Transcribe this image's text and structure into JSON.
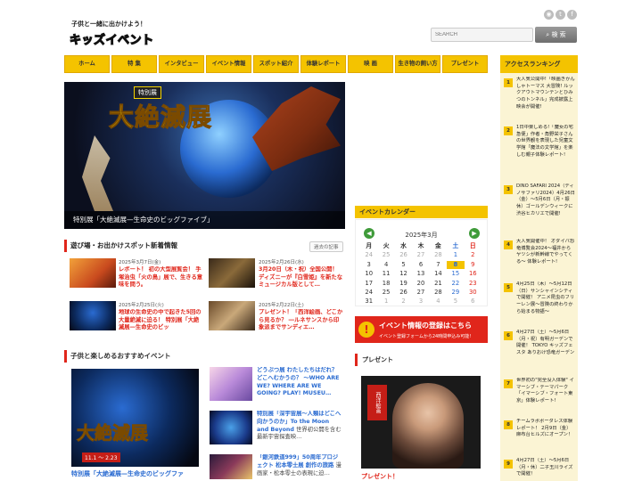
{
  "header": {
    "tagline": "子供と一緒に出かけよう！",
    "logo": "キッズイベント",
    "search_placeholder": "SEARCH",
    "search_button": "検 索",
    "social": [
      "rss-icon",
      "twitter-icon",
      "facebook-icon"
    ]
  },
  "nav": [
    "ホーム",
    "特 集",
    "インタビュー",
    "イベント情報",
    "スポット紹介",
    "体験レポート",
    "映 画",
    "生き物の飼い方",
    "プレゼント"
  ],
  "hero": {
    "badge": "特別展",
    "title": "大絶滅展",
    "caption": "特別展「大絶滅展—生命史のビッグファイブ」"
  },
  "news": {
    "heading": "遊び場・お出かけスポット新着情報",
    "more": "過去の記事",
    "items": [
      {
        "date": "2025年3月7日(金)",
        "title": "レポート！ 初の大型展覧会！ 手塚治虫「火の鳥」展で、生きる意味を問う。"
      },
      {
        "date": "2025年2月26日(水)",
        "title": "3月20日（木・祝）全国公開！ ディズニーが『白雪姫』を新たなミュージカル版として…"
      },
      {
        "date": "2025年2月25日(火)",
        "title": "地球の生命史の中で起きた5回の大量絶滅に迫る！ 特別展「大絶滅展—生命史のビッ"
      },
      {
        "date": "2025年2月22日(土)",
        "title": "プレゼント！「西洋絵画、どこから見るか？ ―ルネサンスから印象派までサンディエ…"
      }
    ]
  },
  "calendar": {
    "heading": "イベントカレンダー",
    "month": "2025年3月",
    "weekdays": [
      "月",
      "火",
      "水",
      "木",
      "金",
      "土",
      "日"
    ],
    "days": [
      "24",
      "25",
      "26",
      "27",
      "28",
      "1",
      "2",
      "3",
      "4",
      "5",
      "6",
      "7",
      "8",
      "9",
      "10",
      "11",
      "12",
      "13",
      "14",
      "15",
      "16",
      "17",
      "18",
      "19",
      "20",
      "21",
      "22",
      "23",
      "24",
      "25",
      "26",
      "27",
      "28",
      "29",
      "30",
      "31",
      "1",
      "2",
      "3",
      "4",
      "5",
      "6"
    ],
    "highlight": "8"
  },
  "banner": {
    "title": "イベント情報の登録はこちら",
    "sub": "イベント登録フォームから24時間申込み可能!"
  },
  "present": {
    "heading": "プレゼント",
    "tag": "西洋絵画",
    "label": "プレゼント！"
  },
  "reco": {
    "heading": "子供と楽しめるおすすめイベント",
    "big_title": "大絶滅展",
    "big_date": "11.1 ～ 2.23",
    "big_caption": "特別展「大絶滅展—生命史のビッグファ",
    "items": [
      {
        "title": "どうぶつ展 わたしたちはだれ？ どこへむかうの？ ～WHO ARE WE? WHERE ARE WE GOING? PLAY! MUSEU…",
        "sub": ""
      },
      {
        "title": "特別展「深宇宙展～人類はどこへ向かうのか」To the Moon and Beyond",
        "sub": "世界初公開を含む最新宇宙探査映…"
      },
      {
        "title": "「銀河鉄道999」50周年プロジェクト 松本零士展 創作の旅路",
        "sub": "漫画家・松本零士の表現に迫…"
      }
    ]
  },
  "ranking": {
    "heading": "アクセスランキング",
    "items": [
      "大人気公開中!「映画きかんしゃトーマス 大冒険! ルックアウトマウンテンとひみつのトンネル」完成披露上映会が開催!",
      "1日中楽しめる!「魔女の宅急便」作者・角野栄子さんの世界観を表現した児童文学館「魔法の文学館」を楽しむ親子体験レポート!",
      "DINO SAFARI 2024（ディノサファリ2024）4月26日（金）～5月6日（月・振休）ゴールデンウィークに渋谷ヒカリエで開催!",
      "大人気開催中！ オダイバ恐竜博覧会2024～福井からヤツシが新幹線でやってくる～ 体験レポート!",
      "4月25日（木）～5月12日（日）サンシャインシティで開催！ アニメ昆虫のフリーレン展～冒険の終わりから始まる物語～",
      "4月27日（土）～5月6日（月・祝）有明ガーデンで開催！ TOKYO キッズフェスタ ありおけ恐竜ガーデン",
      "世界初の\"完全没入体験\" イマーシブ・テーマパーク「イマーシブ・フォート東京」体験レポート!",
      "チームラボボーダレス体験レポート！ 2月9日（金）麻布台ヒルズにオープン！",
      "4月27日（土）～5月6日（月・休）二子玉川ライズで開催！"
    ]
  },
  "colors": {
    "accent_yellow": "#f4c300",
    "accent_red": "#e0261b",
    "link_blue": "#2a6bd1"
  }
}
